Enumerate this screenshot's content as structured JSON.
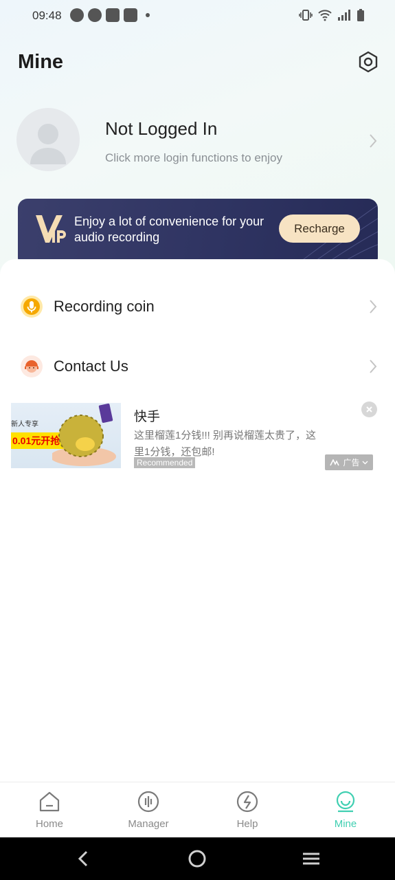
{
  "status_bar": {
    "time": "09:48"
  },
  "header": {
    "title": "Mine"
  },
  "profile": {
    "name": "Not Logged In",
    "subtitle": "Click more login functions to enjoy"
  },
  "vip_banner": {
    "logo_text": "VIP",
    "text": "Enjoy a lot of convenience for your audio recording",
    "button_label": "Recharge"
  },
  "menu": [
    {
      "label": "Recording coin",
      "icon": "microphone-icon"
    },
    {
      "label": "Contact Us",
      "icon": "support-agent-icon"
    }
  ],
  "ad": {
    "title": "快手",
    "description": "这里榴莲1分钱!!! 别再说榴莲太贵了，这里1分钱，还包邮!",
    "recommended_label": "Recommended",
    "badge_label": "广告",
    "image_promo_top": "新人专享",
    "image_promo": "0.01元开抢"
  },
  "tabs": [
    {
      "label": "Home",
      "icon": "home-icon",
      "active": false
    },
    {
      "label": "Manager",
      "icon": "audio-bars-icon",
      "active": false
    },
    {
      "label": "Help",
      "icon": "help-icon",
      "active": false
    },
    {
      "label": "Mine",
      "icon": "smile-user-icon",
      "active": true
    }
  ],
  "colors": {
    "accent": "#3fcfb1",
    "vip_bg": "#2f3462",
    "vip_button": "#f7e3c3",
    "coin": "#f5a800"
  }
}
